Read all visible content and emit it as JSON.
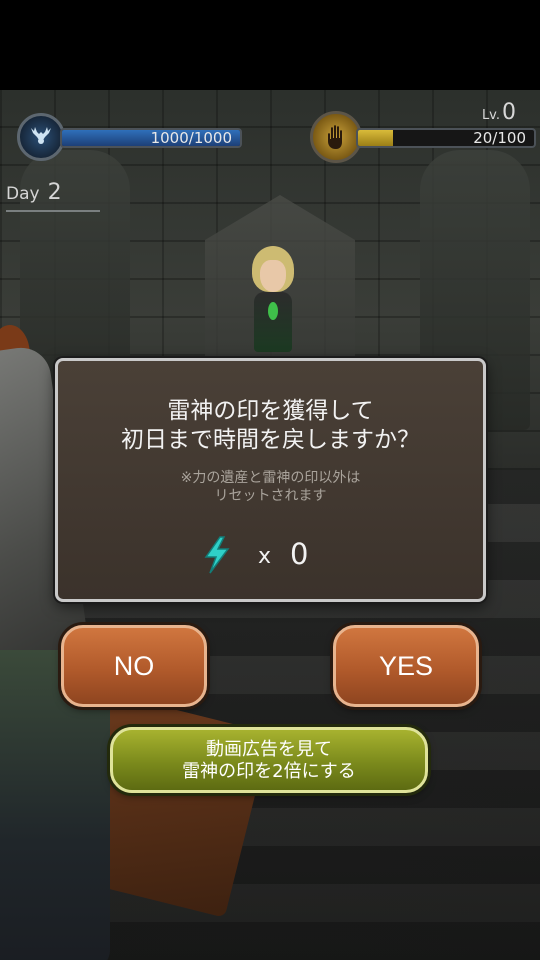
{
  "hud": {
    "hp_text": "1000/1000",
    "hp_fraction": 1.0,
    "exp_text": "20/100",
    "exp_fraction": 0.2,
    "level_label": "Lv.",
    "level_value": "0",
    "day_label": "Day",
    "day_value": "2"
  },
  "dialog": {
    "title": "雷神の印を獲得して\n初日まで時間を戻しますか？",
    "note": "※力の遺産と雷神の印以外は\nリセットされます",
    "count_prefix": "x",
    "count_value": "0"
  },
  "buttons": {
    "no_label": "NO",
    "yes_label": "YES",
    "ad_label": "動画広告を見て\n雷神の印を2倍にする"
  },
  "icons": {
    "hp": "deer-crest-icon",
    "exp": "hand-icon",
    "reward": "lightning-icon"
  },
  "colors": {
    "hp_bar": "#2f6fba",
    "exp_bar": "#d9bb3a",
    "button_orange": "#b15a2b",
    "button_green": "#7b8a1c",
    "bolt": "#2fd0c8"
  }
}
